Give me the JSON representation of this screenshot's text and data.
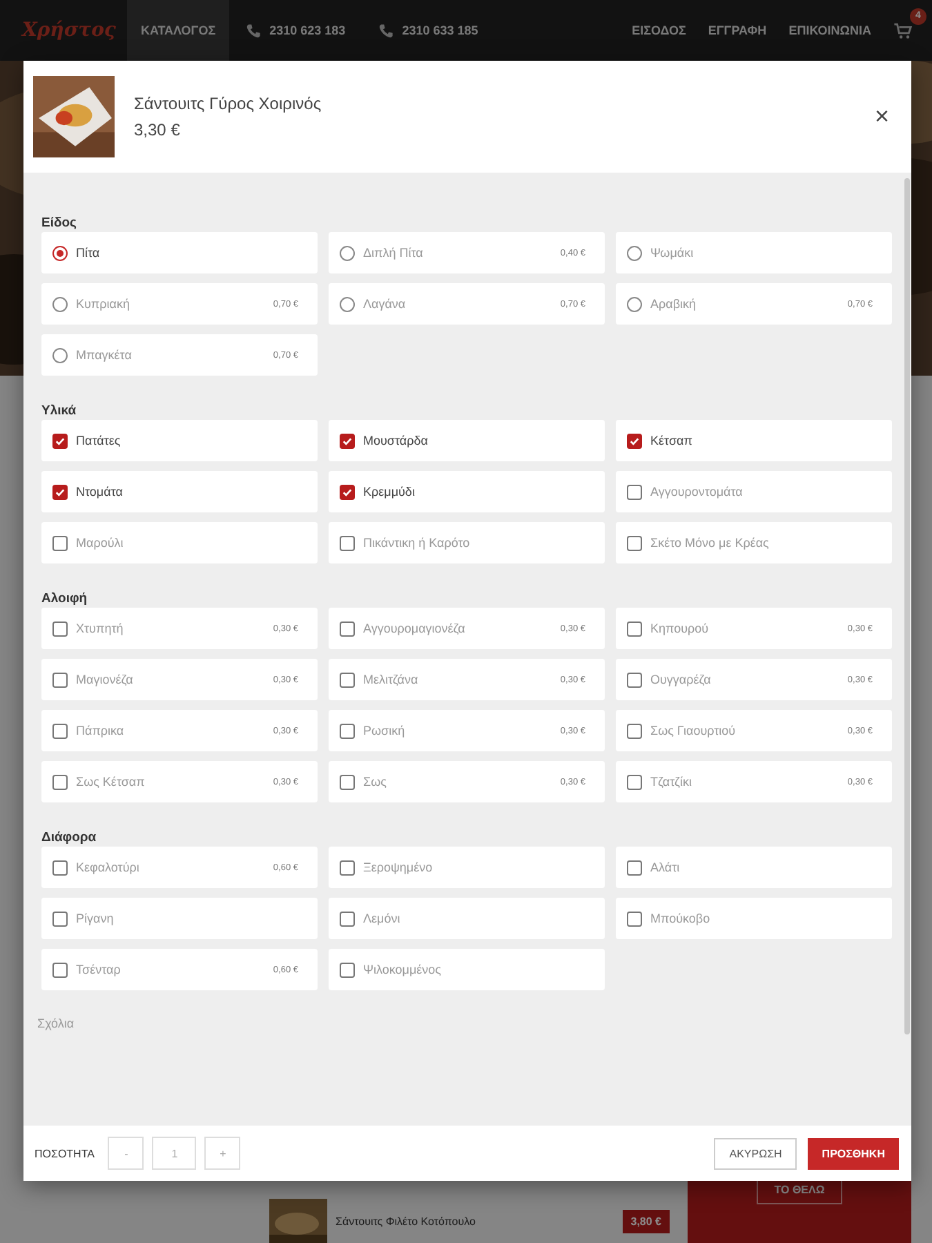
{
  "navbar": {
    "brand": "Χρήστος",
    "items": [
      {
        "label": "ΚΑΤΑΛΟΓΟΣ",
        "selected": true
      }
    ],
    "phones": [
      "2310 623 183",
      "2310 633 185"
    ],
    "links": [
      "ΕΙΣΟΔΟΣ",
      "ΕΓΓΡΑΦΗ",
      "ΕΠΙΚΟΙΝΩΝΙΑ"
    ],
    "cart_count": "4"
  },
  "background_product": {
    "name": "Σάντουιτς Φιλέτο Κοτόπουλο",
    "price": "3,80 €",
    "button": "ΤΟ ΘΕΛΩ"
  },
  "modal": {
    "title": "Σάντουιτς Γύρος Χοιρινός",
    "price": "3,30 €",
    "close": "×",
    "sections": [
      {
        "title": "Είδος",
        "kind": "radio",
        "options": [
          {
            "label": "Πίτα",
            "selected": true
          },
          {
            "label": "Διπλή Πίτα",
            "price": "0,40 €",
            "selected": false
          },
          {
            "label": "Ψωμάκι",
            "selected": false
          },
          {
            "label": "Κυπριακή",
            "price": "0,70 €",
            "selected": false
          },
          {
            "label": "Λαγάνα",
            "price": "0,70 €",
            "selected": false
          },
          {
            "label": "Αραβική",
            "price": "0,70 €",
            "selected": false
          },
          {
            "label": "Μπαγκέτα",
            "price": "0,70 €",
            "selected": false
          }
        ]
      },
      {
        "title": "Υλικά",
        "kind": "checkbox",
        "options": [
          {
            "label": "Πατάτες",
            "checked": true
          },
          {
            "label": "Μουστάρδα",
            "checked": true
          },
          {
            "label": "Κέτσαπ",
            "checked": true
          },
          {
            "label": "Ντομάτα",
            "checked": true
          },
          {
            "label": "Κρεμμύδι",
            "checked": true
          },
          {
            "label": "Αγγουροντομάτα",
            "checked": false
          },
          {
            "label": "Μαρούλι",
            "checked": false
          },
          {
            "label": "Πικάντικη ή Καρότο",
            "checked": false
          },
          {
            "label": "Σκέτο Μόνο με Κρέας",
            "checked": false
          }
        ]
      },
      {
        "title": "Αλοιφή",
        "kind": "checkbox",
        "options": [
          {
            "label": "Χτυπητή",
            "price": "0,30 €",
            "checked": false
          },
          {
            "label": "Αγγουρομαγιονέζα",
            "price": "0,30 €",
            "checked": false
          },
          {
            "label": "Κηπουρού",
            "price": "0,30 €",
            "checked": false
          },
          {
            "label": "Μαγιονέζα",
            "price": "0,30 €",
            "checked": false
          },
          {
            "label": "Μελιτζάνα",
            "price": "0,30 €",
            "checked": false
          },
          {
            "label": "Ουγγαρέζα",
            "price": "0,30 €",
            "checked": false
          },
          {
            "label": "Πάπρικα",
            "price": "0,30 €",
            "checked": false
          },
          {
            "label": "Ρωσική",
            "price": "0,30 €",
            "checked": false
          },
          {
            "label": "Σως Γιαουρτιού",
            "price": "0,30 €",
            "checked": false
          },
          {
            "label": "Σως Κέτσαπ",
            "price": "0,30 €",
            "checked": false
          },
          {
            "label": "Σως",
            "price": "0,30 €",
            "checked": false
          },
          {
            "label": "Τζατζίκι",
            "price": "0,30 €",
            "checked": false
          }
        ]
      },
      {
        "title": "Διάφορα",
        "kind": "checkbox",
        "options": [
          {
            "label": "Κεφαλοτύρι",
            "price": "0,60 €",
            "checked": false
          },
          {
            "label": "Ξεροψημένο",
            "checked": false
          },
          {
            "label": "Αλάτι",
            "checked": false
          },
          {
            "label": "Ρίγανη",
            "checked": false
          },
          {
            "label": "Λεμόνι",
            "checked": false
          },
          {
            "label": "Μπούκοβο",
            "checked": false
          },
          {
            "label": "Τσένταρ",
            "price": "0,60 €",
            "checked": false
          },
          {
            "label": "Ψιλοκομμένος",
            "checked": false
          }
        ]
      }
    ],
    "comments_label": "Σχόλια",
    "quantity": {
      "label": "ΠΟΣΟΤΗΤΑ",
      "minus": "-",
      "value": "1",
      "plus": "+"
    },
    "buttons": {
      "cancel": "ΑΚΥΡΩΣΗ",
      "add": "ΠΡΟΣΘΗΚΗ"
    }
  }
}
